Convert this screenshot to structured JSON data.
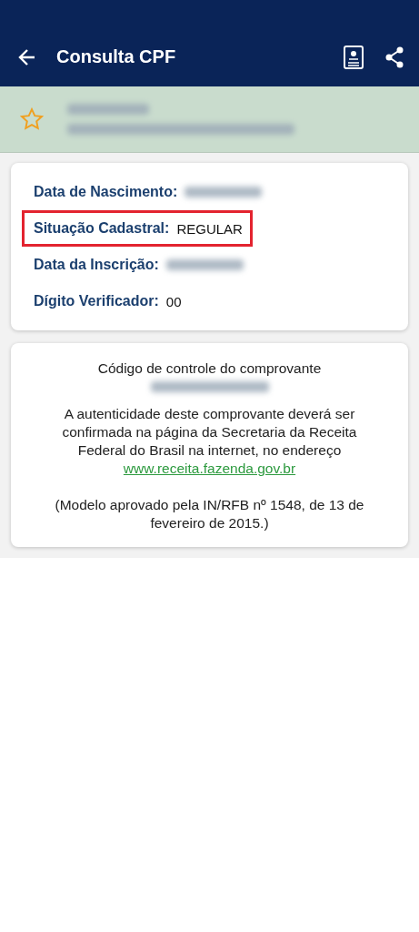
{
  "header": {
    "title": "Consulta CPF"
  },
  "person": {
    "favorite": false,
    "cpf": {
      "redacted": true
    },
    "name": {
      "redacted": true
    }
  },
  "fields": [
    {
      "label": "Data de Nascimento:",
      "redacted": true,
      "highlighted": false
    },
    {
      "label": "Situação Cadastral:",
      "value": "REGULAR",
      "redacted": false,
      "highlighted": true
    },
    {
      "label": "Data da Inscrição:",
      "redacted": true,
      "highlighted": false
    },
    {
      "label": "Dígito Verificador:",
      "value": "00",
      "redacted": false,
      "highlighted": false
    }
  ],
  "receipt": {
    "code_title": "Código de controle do comprovante",
    "code": {
      "redacted": true
    },
    "notice": "A autenticidade deste comprovante deverá ser confirmada na página da Secretaria da Receita Federal do Brasil na internet, no endereço",
    "link": "www.receita.fazenda.gov.br",
    "footnote": "(Modelo aprovado pela IN/RFB nº 1548, de 13 de fevereiro de 2015.)"
  }
}
